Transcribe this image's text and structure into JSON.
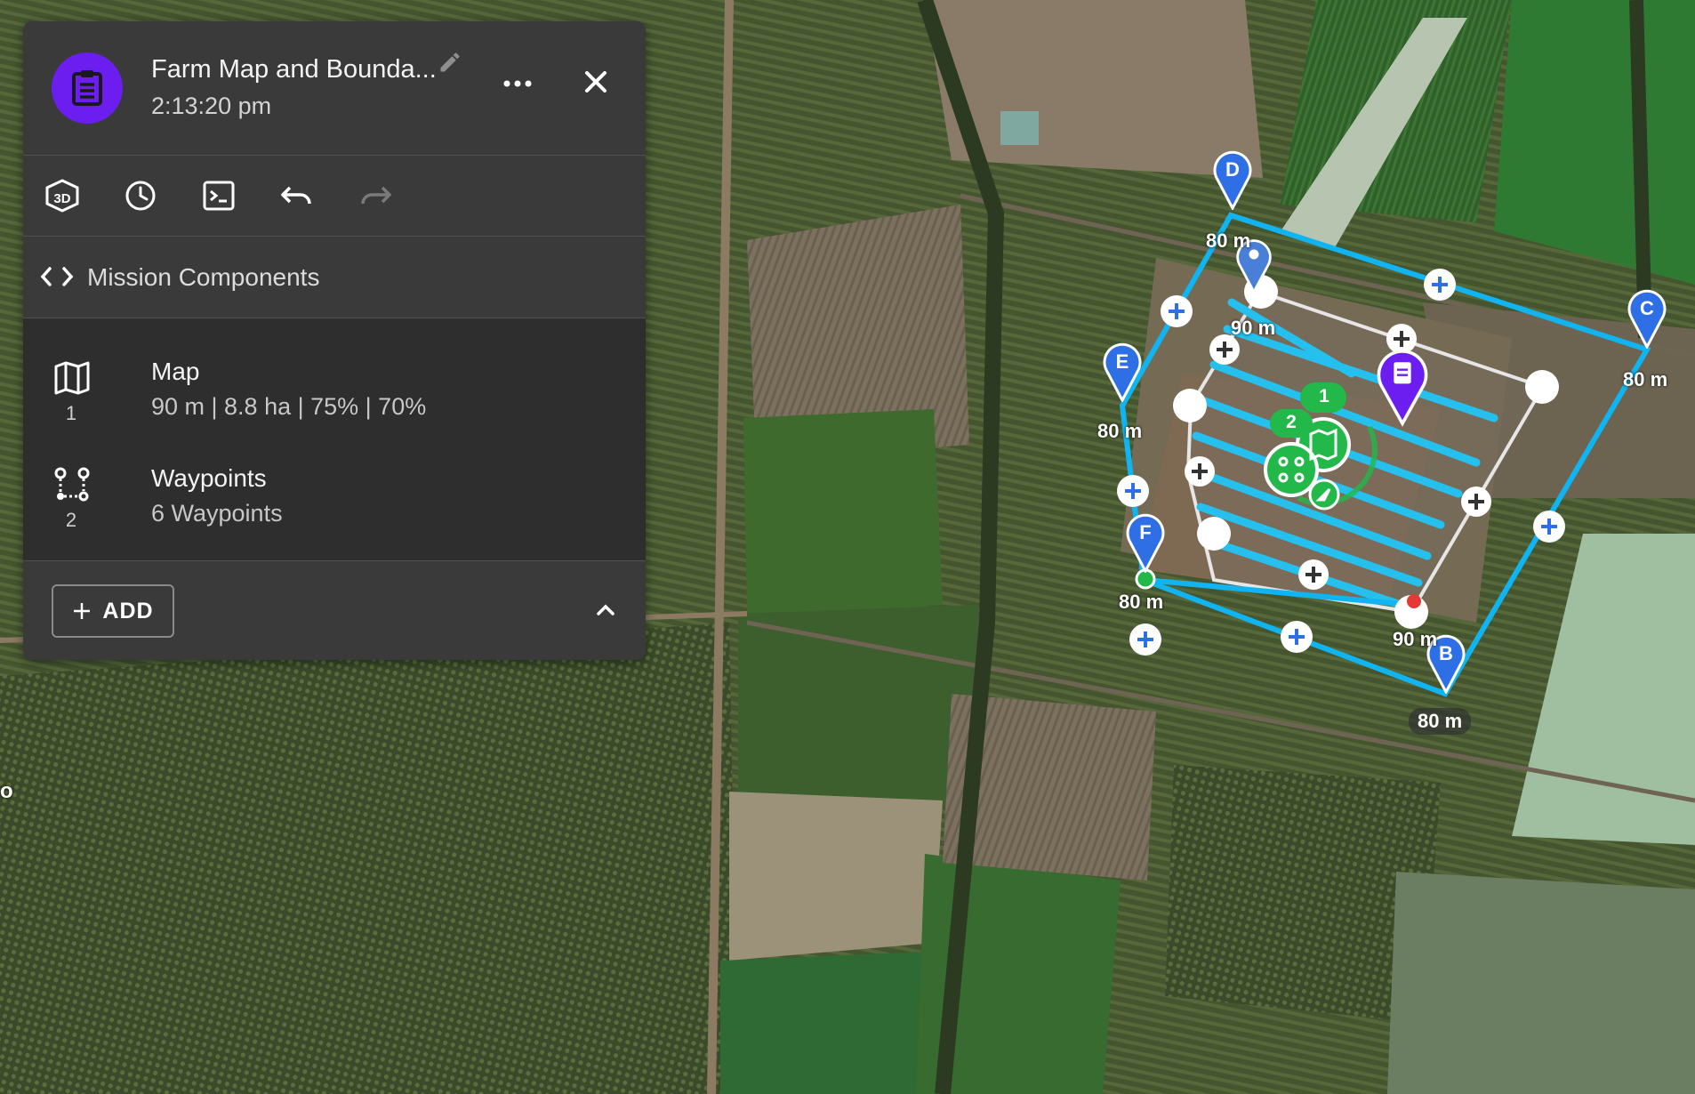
{
  "panel": {
    "title": "Farm Map and Bounda...",
    "time": "2:13:20 pm",
    "section_label": "Mission Components",
    "add_label": "ADD",
    "components": [
      {
        "name": "Map",
        "index": "1",
        "summary": "90 m | 8.8 ha | 75% | 70%",
        "icon": "map-icon"
      },
      {
        "name": "Waypoints",
        "index": "2",
        "summary": "6 Waypoints",
        "icon": "waypoints-route-icon"
      }
    ],
    "toolbar": [
      "3d-view-icon",
      "clock-icon",
      "terminal-icon",
      "undo-icon",
      "redo-icon"
    ]
  },
  "map": {
    "waypoints": [
      {
        "letter": "D",
        "altitude": "80 m"
      },
      {
        "letter": "C",
        "altitude": "80 m"
      },
      {
        "letter": "E",
        "altitude": "80 m"
      },
      {
        "letter": "F",
        "altitude": "80 m"
      },
      {
        "letter": "B",
        "altitude": "80 m"
      }
    ],
    "map_altitude_top": "90 m",
    "map_altitude_bottom": "90 m",
    "component_badges": [
      "1",
      "2"
    ],
    "edge_labels": [
      "o"
    ],
    "colors": {
      "boundary": "#10b4f0",
      "pin": "#2f6fe6",
      "mission": "#6c1ef0",
      "component": "#22b84a"
    }
  }
}
